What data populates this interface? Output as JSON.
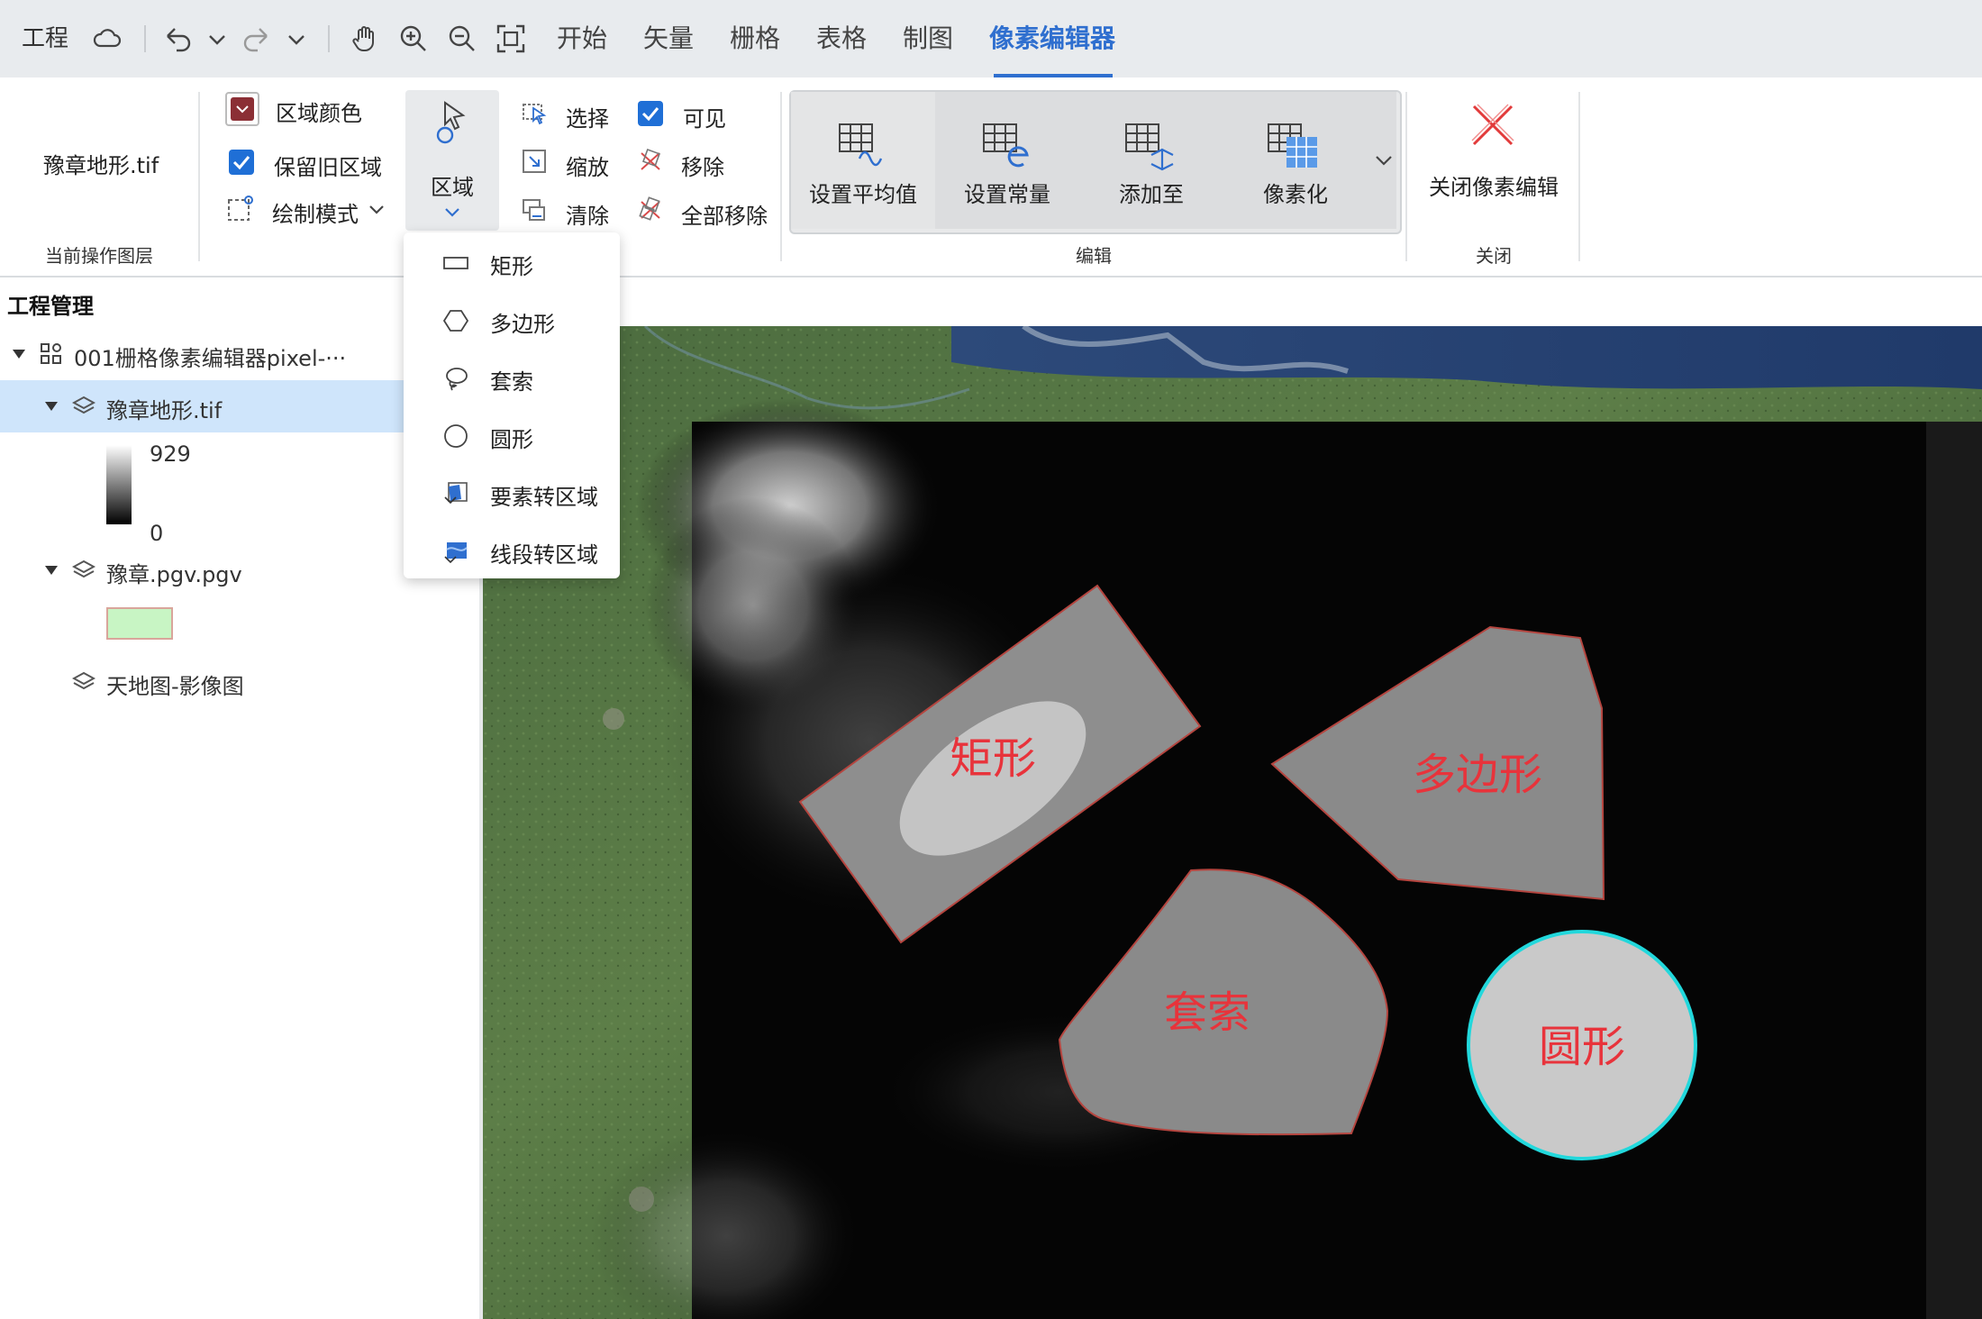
{
  "menubar": {
    "project": "工程",
    "tabs": [
      {
        "label": "开始"
      },
      {
        "label": "矢量"
      },
      {
        "label": "栅格"
      },
      {
        "label": "表格"
      },
      {
        "label": "制图"
      },
      {
        "label": "像素编辑器",
        "active": true
      }
    ]
  },
  "ribbon": {
    "current_layer": {
      "name": "豫章地形.tif",
      "group_label": "当前操作图层"
    },
    "region_color": {
      "label": "区域颜色",
      "color": "#8b2f35"
    },
    "keep_old_region": {
      "label": "保留旧区域",
      "checked": true
    },
    "draw_mode": {
      "label": "绘制模式"
    },
    "region_button": {
      "label": "区域"
    },
    "select": {
      "label": "选择"
    },
    "zoom": {
      "label": "缩放"
    },
    "clear": {
      "label": "清除"
    },
    "visible": {
      "label": "可见",
      "checked": true
    },
    "remove": {
      "label": "移除"
    },
    "remove_all": {
      "label": "全部移除"
    },
    "edit": {
      "set_average": "设置平均值",
      "set_constant": "设置常量",
      "add_to": "添加至",
      "pixelate": "像素化",
      "group_label": "编辑"
    },
    "close": {
      "label": "关闭像素编辑",
      "group_label": "关闭"
    }
  },
  "dropdown": {
    "items": [
      {
        "label": "矩形",
        "icon": "rectangle-icon"
      },
      {
        "label": "多边形",
        "icon": "polygon-icon"
      },
      {
        "label": "套索",
        "icon": "lasso-icon"
      },
      {
        "label": "圆形",
        "icon": "circle-icon"
      },
      {
        "label": "要素转区域",
        "icon": "feature-to-region-icon"
      },
      {
        "label": "线段转区域",
        "icon": "line-to-region-icon"
      }
    ]
  },
  "panel": {
    "title": "工程管理",
    "project_name": "001栅格像素编辑器pixel-···",
    "layers": [
      {
        "name": "豫章地形.tif",
        "selected": true,
        "legend_max": "929",
        "legend_min": "0"
      },
      {
        "name": "豫章.pgv.pgv",
        "swatch_fill": "#c8f5c4",
        "swatch_border": "#d9a59b"
      },
      {
        "name": "天地图-影像图"
      }
    ]
  },
  "map": {
    "regions": [
      {
        "label": "矩形",
        "shape": "rectangle"
      },
      {
        "label": "多边形",
        "shape": "polygon"
      },
      {
        "label": "套索",
        "shape": "lasso"
      },
      {
        "label": "圆形",
        "shape": "circle",
        "outline": "#22d8dc"
      }
    ],
    "region_label_color": "#e8333b"
  }
}
